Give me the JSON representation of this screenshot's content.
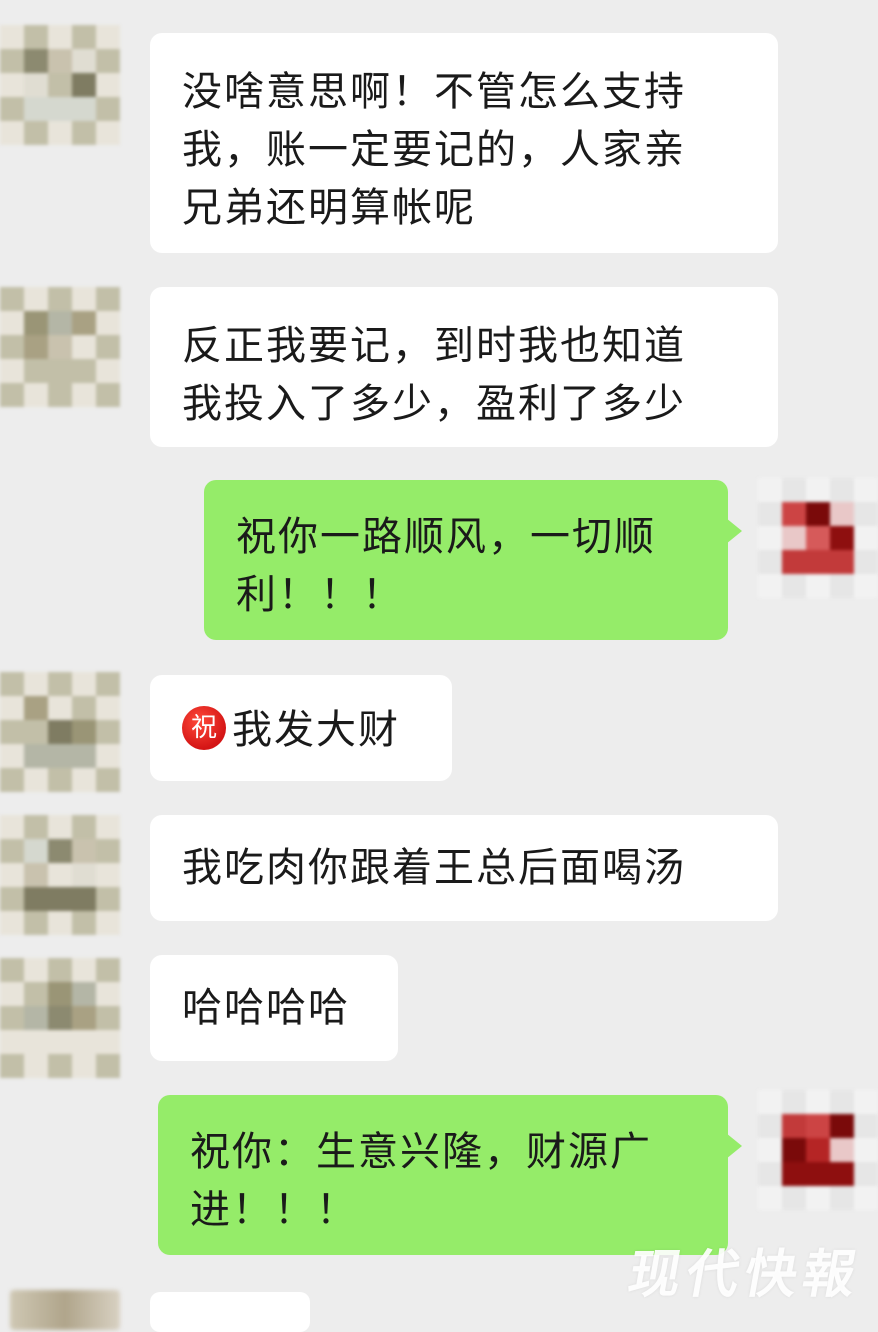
{
  "messages": [
    {
      "side": "left",
      "lines": [
        "没啥意思啊！不管怎么支持",
        "我，账一定要记的，人家亲",
        "兄弟还明算帐呢"
      ]
    },
    {
      "side": "left",
      "lines": [
        "反正我要记，到时我也知道",
        "我投入了多少，盈利了多少"
      ]
    },
    {
      "side": "right",
      "lines": [
        "祝你一路顺风，一切顺",
        "利！！！"
      ]
    },
    {
      "side": "left",
      "icon_text": "祝",
      "icon": "wish-emoji-icon",
      "lines": [
        "我发大财"
      ]
    },
    {
      "side": "left",
      "lines": [
        "我吃肉你跟着王总后面喝汤"
      ]
    },
    {
      "side": "left",
      "lines": [
        "哈哈哈哈"
      ]
    },
    {
      "side": "right",
      "lines": [
        "祝你：生意兴隆，财源广",
        "进！！！"
      ]
    }
  ],
  "watermark": "现代快報",
  "colors": {
    "background": "#ededed",
    "left_bubble": "#ffffff",
    "right_bubble": "#95ec69",
    "text": "#1a1a1a",
    "wish_icon": "#d41515"
  },
  "avatar_palettes": {
    "left": [
      "#e8e4da",
      "#c9c2ae",
      "#a9a183",
      "#8c8a70",
      "#b4b6a6",
      "#d5d8cf",
      "#9a9576",
      "#7f7c62",
      "#c2bfa8",
      "#e0ddd2"
    ],
    "right": [
      "#f2f2f2",
      "#c23a3a",
      "#a01818",
      "#8e0f0f",
      "#d65a5a",
      "#e9c8c8",
      "#b52525",
      "#7a0a0a",
      "#e6e6e6",
      "#cc4444"
    ]
  }
}
